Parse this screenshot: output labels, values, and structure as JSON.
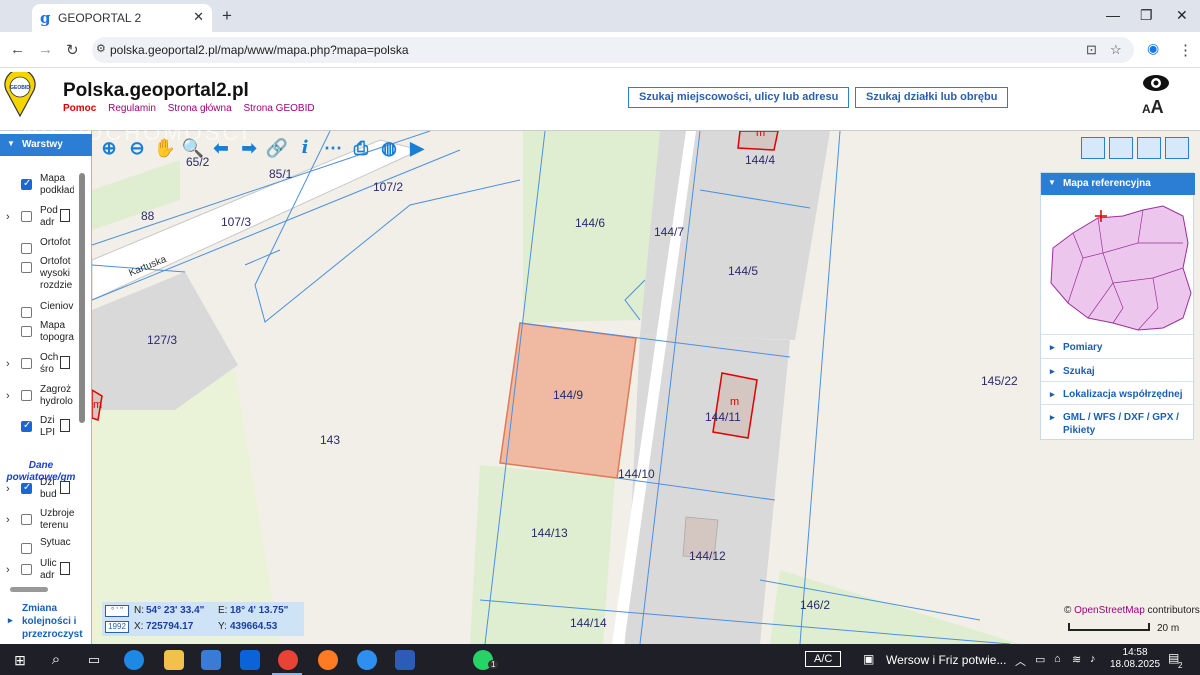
{
  "browser": {
    "tab_title": "GEOPORTAL 2",
    "tab_icon": "g",
    "url": "polska.geoportal2.pl/map/www/mapa.php?mapa=polska"
  },
  "site": {
    "title": "Polska.geoportal2.pl",
    "logo_text": "GEOBID",
    "links": [
      "Pomoc",
      "Regulamin",
      "Strona główna",
      "Strona GEOBID"
    ],
    "search_place_button": "Szukaj miejscowości, ulicy lub adresu",
    "search_parcel_button": "Szukaj działki lub obrębu",
    "font_size_label_small": "A",
    "font_size_label_big": "A"
  },
  "layers_panel": {
    "title": "Warstwy",
    "items": [
      {
        "label": "Mapa podkład",
        "checked": true,
        "expandable": false,
        "doc": false
      },
      {
        "label": "Pod adr",
        "checked": false,
        "expandable": true,
        "doc": true
      },
      {
        "label": "Ortofot",
        "checked": false,
        "expandable": false,
        "doc": false
      },
      {
        "label": "Ortofot wysoki rozdzie",
        "checked": false,
        "expandable": false,
        "doc": false
      },
      {
        "label": "Cieniov",
        "checked": false,
        "expandable": false,
        "doc": false
      },
      {
        "label": "Mapa topogra",
        "checked": false,
        "expandable": false,
        "doc": false
      },
      {
        "label": "Och śro",
        "checked": false,
        "expandable": true,
        "doc": true
      },
      {
        "label": "Zagroż hydrolo",
        "checked": false,
        "expandable": true,
        "doc": false
      },
      {
        "label": "Dzi LPI",
        "checked": true,
        "expandable": false,
        "doc": true
      },
      {
        "label": "Dzi bud",
        "checked": true,
        "expandable": true,
        "doc": true
      },
      {
        "label": "Uzbroje terenu",
        "checked": false,
        "expandable": true,
        "doc": false
      },
      {
        "label": "Sytuac",
        "checked": false,
        "expandable": false,
        "doc": false
      },
      {
        "label": "Ulic adr",
        "checked": false,
        "expandable": true,
        "doc": true
      }
    ],
    "section_label": "Dane powiatowe/gm",
    "order_label": "Zmiana kolejności i przezroczyst"
  },
  "map": {
    "street_name": "Kartuska",
    "parcels": [
      "85/1",
      "107/2",
      "88",
      "107/3",
      "144/6",
      "144/7",
      "144/4",
      "144/5",
      "127/3",
      "144/9",
      "144/11",
      "143",
      "144/10",
      "145/22",
      "144/13",
      "144/12",
      "146/2",
      "144/14",
      "65/2"
    ],
    "building_marker": "m",
    "highlight_color": "#f0b9a1",
    "parcel_line_color": "#4a90e2",
    "building_outline_color": "#e00000",
    "watermark": "NIERUCHOMOŚCI"
  },
  "right_panel": {
    "title": "Mapa referencyjna",
    "items": [
      "Pomiary",
      "Szukaj",
      "Lokalizacja współrzędnej",
      "GML / WFS / DXF / GPX / Pikiety"
    ]
  },
  "coordinates": {
    "format_badge": "° ' \"",
    "system_badge": "1992",
    "n_label": "N:",
    "n_value": "54° 23' 33.4\"",
    "e_label": "E:",
    "e_value": "18° 4' 13.75\"",
    "x_label": "X:",
    "x_value": "725794.17",
    "y_label": "Y:",
    "y_value": "439664.53"
  },
  "attribution": {
    "prefix": "©",
    "link": "OpenStreetMap",
    "suffix": "contributors",
    "scale": "20 m"
  },
  "taskbar": {
    "notification_text": "Wersow i Friz potwie...",
    "whatsapp_badge": "1",
    "ac_label": "A/C",
    "time": "14:58",
    "date": "18.08.2025",
    "notifications_badge": "2"
  }
}
